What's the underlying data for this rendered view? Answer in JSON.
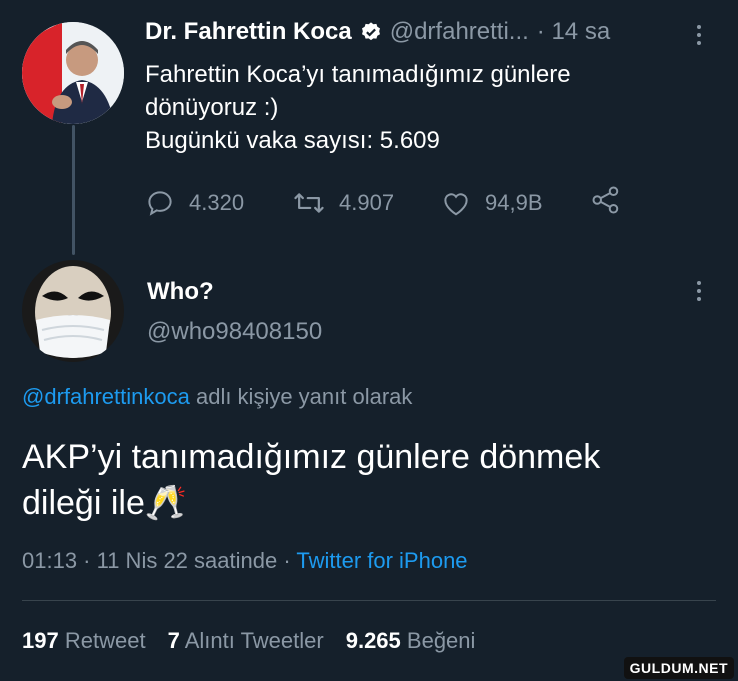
{
  "tweet1": {
    "name": "Dr. Fahrettin Koca",
    "handle": "@drfahretti...",
    "time": "· 14 sa",
    "text_line1": "Fahrettin Koca’yı tanımadığımız günlere",
    "text_line2": "dönüyoruz :)",
    "text_line3": "Bugünkü vaka sayısı: 5.609",
    "replies": "4.320",
    "retweets": "4.907",
    "likes": "94,9B"
  },
  "reply": {
    "name": "Who?",
    "handle": "@who98408150",
    "replying_handle": "@drfahrettinkoca",
    "replying_suffix": " adlı kişiye yanıt olarak",
    "text_line1": "AKP’yi tanımadığımız günlere dönmek",
    "text_line2": "dileği ile🥂",
    "meta": "01:13 · 11 Nis 22 saatinde · ",
    "source": "Twitter for iPhone"
  },
  "stats": {
    "retweet_count": "197",
    "retweet_label": "Retweet",
    "quote_count": "7",
    "quote_label": "Alıntı Tweetler",
    "like_count": "9.265",
    "like_label": "Beğeni"
  },
  "watermark": "GULDUM.NET",
  "colors": {
    "background": "#15202b",
    "link": "#1d9bf0",
    "muted": "#8b98a5",
    "verified": "#ffffff"
  }
}
